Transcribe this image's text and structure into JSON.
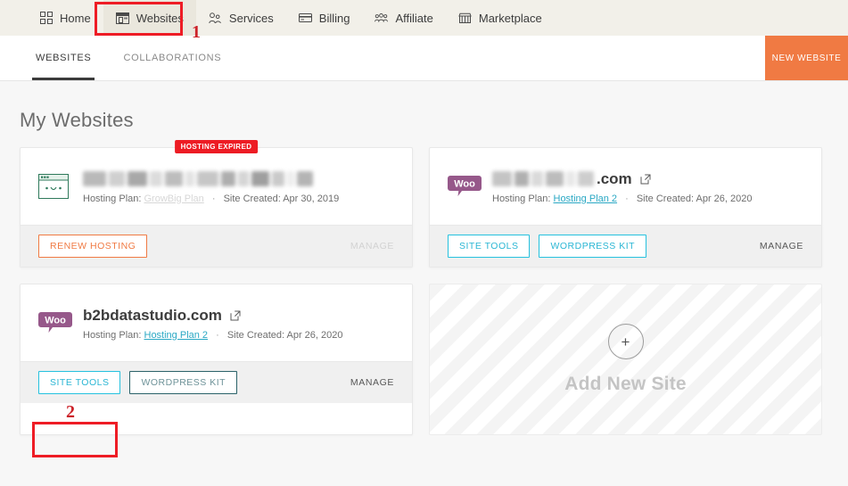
{
  "topnav": {
    "items": [
      {
        "label": "Home",
        "icon": "grid-icon",
        "active": false
      },
      {
        "label": "Websites",
        "icon": "browser-window-icon",
        "active": true
      },
      {
        "label": "Services",
        "icon": "services-people-icon",
        "active": false
      },
      {
        "label": "Billing",
        "icon": "credit-card-icon",
        "active": false
      },
      {
        "label": "Affiliate",
        "icon": "affiliate-people-icon",
        "active": false
      },
      {
        "label": "Marketplace",
        "icon": "store-icon",
        "active": false
      }
    ]
  },
  "subnav": {
    "tabs": [
      {
        "label": "WEBSITES",
        "active": true
      },
      {
        "label": "COLLABORATIONS",
        "active": false
      }
    ],
    "new_website_label": "NEW WEBSITE"
  },
  "page": {
    "title": "My Websites"
  },
  "cards": [
    {
      "badge": "HOSTING EXPIRED",
      "icon": "sitechecker-window-icon",
      "name_blurred": true,
      "name": "",
      "hosting_plan_label": "Hosting Plan:",
      "hosting_plan_value": "GrowBig Plan",
      "separator": "·",
      "site_created_label": "Site Created:",
      "site_created_value": "Apr 30, 2019",
      "buttons": [
        {
          "label": "RENEW HOSTING",
          "style": "orange"
        }
      ],
      "manage_label": "MANAGE",
      "manage_disabled": true
    },
    {
      "badge": "",
      "icon": "woocommerce-icon",
      "name_blurred": true,
      "name": ".com",
      "hosting_plan_label": "Hosting Plan:",
      "hosting_plan_value": "Hosting Plan 2",
      "separator": "·",
      "site_created_label": "Site Created:",
      "site_created_value": "Apr 26, 2020",
      "buttons": [
        {
          "label": "SITE TOOLS",
          "style": "cyan"
        },
        {
          "label": "WORDPRESS KIT",
          "style": "cyan"
        }
      ],
      "manage_label": "MANAGE",
      "manage_disabled": false
    },
    {
      "badge": "",
      "icon": "woocommerce-icon",
      "name_blurred": false,
      "name": "b2bdatastudio.com",
      "hosting_plan_label": "Hosting Plan:",
      "hosting_plan_value": "Hosting Plan 2",
      "separator": "·",
      "site_created_label": "Site Created:",
      "site_created_value": "Apr 26, 2020",
      "buttons": [
        {
          "label": "SITE TOOLS",
          "style": "cyan"
        },
        {
          "label": "WORDPRESS KIT",
          "style": "teal-dark"
        }
      ],
      "manage_label": "MANAGE",
      "manage_disabled": false
    }
  ],
  "add_new_site": {
    "plus": "+",
    "label": "Add New Site"
  },
  "annotations": [
    {
      "number": "1"
    },
    {
      "number": "2"
    }
  ],
  "colors": {
    "topnav_bg": "#f2f0e9",
    "active_nav_bg": "#eae7dd",
    "accent_orange": "#f07a43",
    "accent_cyan": "#25c1de",
    "badge_red": "#ed1c24",
    "annotation_red": "#ee1c25",
    "woo_purple": "#96588a",
    "teal_dark": "#2b6269"
  }
}
